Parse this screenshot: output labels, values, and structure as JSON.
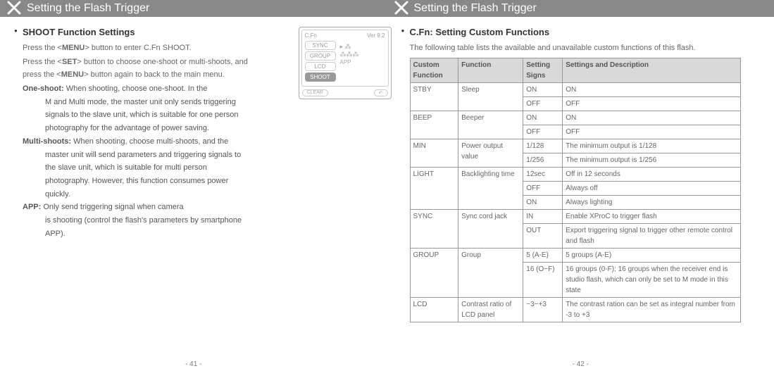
{
  "page_left": {
    "header": "Setting the Flash Trigger",
    "section_title": "SHOOT Function Settings",
    "intro_lines": [
      "Press the <MENU> button to enter C.Fn SHOOT.",
      "Press the <SET> button to choose one-shoot or multi-shoots, and press the <MENU> button again to back to the main menu."
    ],
    "defs": [
      {
        "term": "One-shoot:",
        "desc": "When shooting, choose one-shoot. In the M and Multi mode, the master unit only sends triggering signals to the slave unit, which is suitable for one person photography for the advantage of power saving."
      },
      {
        "term": "Multi-shoots:",
        "desc": "When shooting, choose multi-shoots, and the master unit will send parameters and triggering signals to the slave unit, which is suitable for multi person photography. However, this function consumes power quickly."
      },
      {
        "term": "APP:",
        "desc": "Only send triggering signal when camera is shooting (control the flash's parameters by smartphone APP)."
      }
    ],
    "lcd": {
      "cfn": "C.Fn",
      "ver": "Ver 9.2",
      "items": [
        "SYNC",
        "GROUP",
        "LCD",
        "SHOOT"
      ],
      "selected": "SHOOT",
      "side_arrow": "▸ ⁂",
      "side_people": "⁂⁂⁂",
      "side_app": "APP",
      "clear": "CLEAR",
      "back": "↶"
    },
    "page_num": "- 41 -"
  },
  "page_right": {
    "header": "Setting the Flash Trigger",
    "section_title": "C.Fn: Setting Custom Functions",
    "intro": "The following table lists the available and unavailable custom functions of this flash.",
    "table": {
      "cols": [
        "Custom Function",
        "Function",
        "Setting Signs",
        "Settings and Description"
      ],
      "rows": [
        {
          "cf": "STBY",
          "cf_rs": 2,
          "fn": "Sleep",
          "fn_rs": 2,
          "sign": "ON",
          "desc": "ON"
        },
        {
          "sign": "OFF",
          "desc": "OFF"
        },
        {
          "cf": "BEEP",
          "cf_rs": 2,
          "fn": "Beeper",
          "fn_rs": 2,
          "sign": "ON",
          "desc": "ON"
        },
        {
          "sign": "OFF",
          "desc": "OFF"
        },
        {
          "cf": "MIN",
          "cf_rs": 2,
          "fn": "Power output value",
          "fn_rs": 2,
          "sign": "1/128",
          "desc": "The minimum output is 1/128"
        },
        {
          "sign": "1/256",
          "desc": "The minimum output is 1/256"
        },
        {
          "cf": "LIGHT",
          "cf_rs": 3,
          "fn": "Backlighting time",
          "fn_rs": 3,
          "sign": "12sec",
          "desc": "Off in 12 seconds"
        },
        {
          "sign": "OFF",
          "desc": "Always off"
        },
        {
          "sign": "ON",
          "desc": "Always lighting"
        },
        {
          "cf": "SYNC",
          "cf_rs": 2,
          "fn": "Sync cord jack",
          "fn_rs": 2,
          "sign": "IN",
          "desc": "Enable XProC to trigger flash"
        },
        {
          "sign": "OUT",
          "desc": "Export triggering signal to trigger other remote control and flash"
        },
        {
          "cf": "GROUP",
          "cf_rs": 2,
          "fn": "Group",
          "fn_rs": 2,
          "sign": "5 (A-E)",
          "desc": "5 groups (A-E)"
        },
        {
          "sign": "16 (O−F)",
          "desc": "16 groups (0-F); 16 groups when the receiver end is studio flash, which can only be set to M mode in this state"
        },
        {
          "cf": "LCD",
          "cf_rs": 1,
          "fn": "Contrast ratio of LCD panel",
          "fn_rs": 1,
          "sign": "−3−+3",
          "desc": "The contrast ration can be set as integral number from -3 to +3"
        }
      ]
    },
    "page_num": "- 42 -"
  }
}
